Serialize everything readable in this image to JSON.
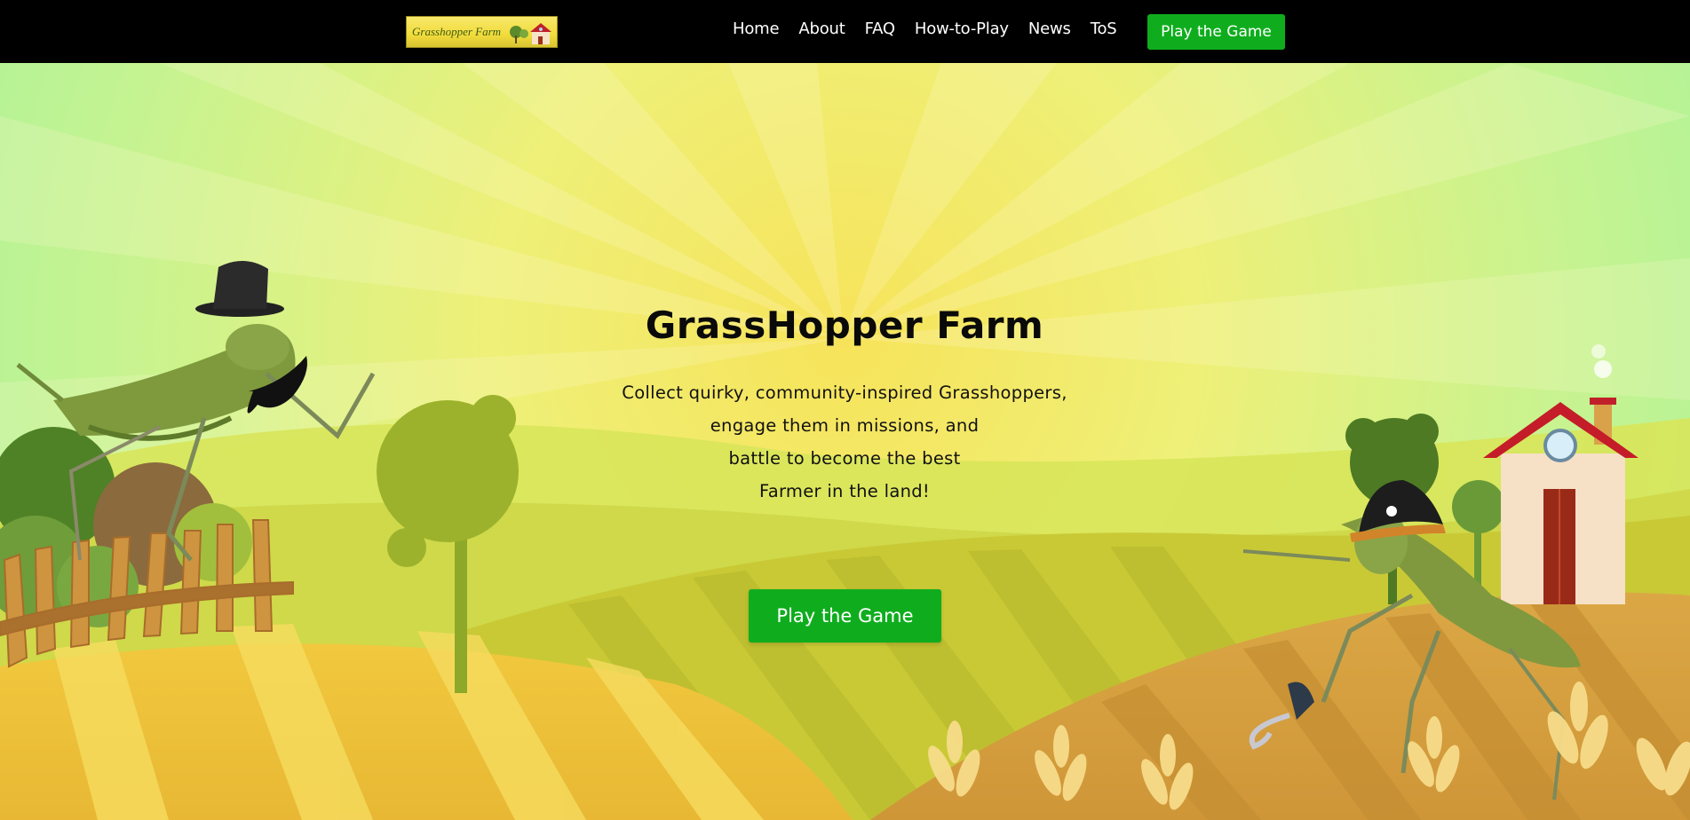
{
  "nav": {
    "logo_text": "Grasshopper Farm",
    "links": [
      {
        "label": "Home"
      },
      {
        "label": "About"
      },
      {
        "label": "FAQ"
      },
      {
        "label": "How-to-Play"
      },
      {
        "label": "News"
      },
      {
        "label": "ToS"
      }
    ],
    "cta_label": "Play the Game"
  },
  "hero": {
    "title": "GrassHopper Farm",
    "description_lines": [
      "Collect quirky, community-inspired Grasshoppers,",
      "engage them in missions, and",
      "battle to become the best",
      "Farmer in the land!"
    ],
    "cta_label": "Play the Game"
  },
  "colors": {
    "nav_background": "#000000",
    "cta_green": "#0fad1e",
    "sky_center": "#f6e55c",
    "sky_top": "#b8f79a",
    "field_gold": "#e9b93c"
  },
  "illustration": {
    "left_character": "grasshopper-top-hat-mustache-icon",
    "right_character": "grasshopper-pirate-hat-hook-icon",
    "scene": [
      "farmhouse-icon",
      "wooden-fence-icon",
      "tree-icon",
      "wheat-icon"
    ]
  }
}
